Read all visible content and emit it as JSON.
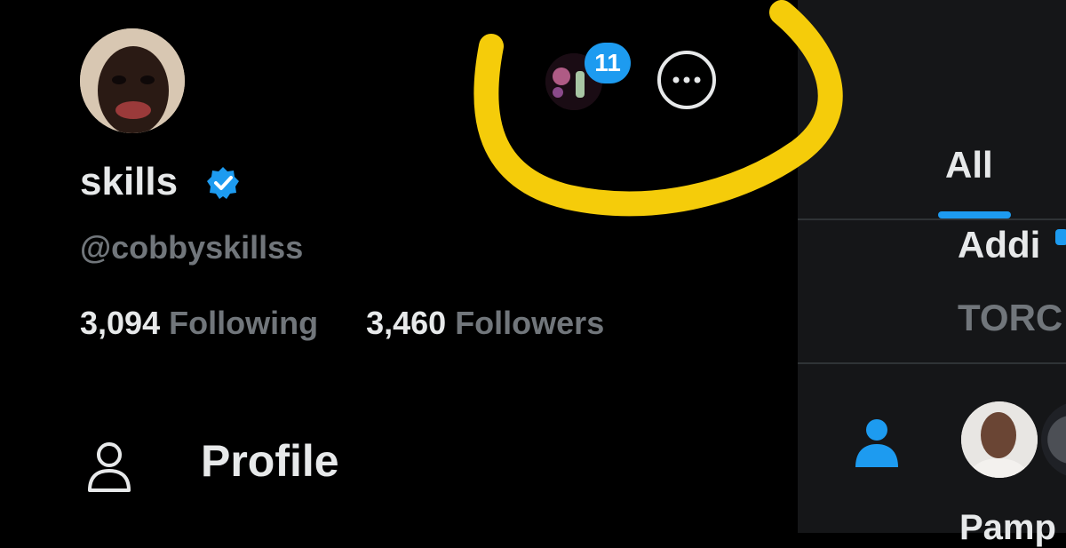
{
  "profile": {
    "display_name": "skills",
    "handle": "@cobbyskillss",
    "verified": true,
    "following_count": "3,094",
    "following_label": "Following",
    "followers_count": "3,460",
    "followers_label": "Followers"
  },
  "account_switcher": {
    "badge_count": "11"
  },
  "nav": {
    "profile_label": "Profile",
    "profile_icon": "person-outline-icon"
  },
  "notifications_pane": {
    "active_tab": "All",
    "item1_name": "Addi",
    "item1_subtext": "TORC",
    "item2_name": "Pamp",
    "item2_icon": "person-icon"
  },
  "colors": {
    "background": "#000000",
    "pane_background": "#151618",
    "primary_text": "#e7e9ea",
    "secondary_text": "#71767b",
    "accent_blue": "#1d9bf0",
    "annotation_yellow": "#f5cc0a"
  }
}
